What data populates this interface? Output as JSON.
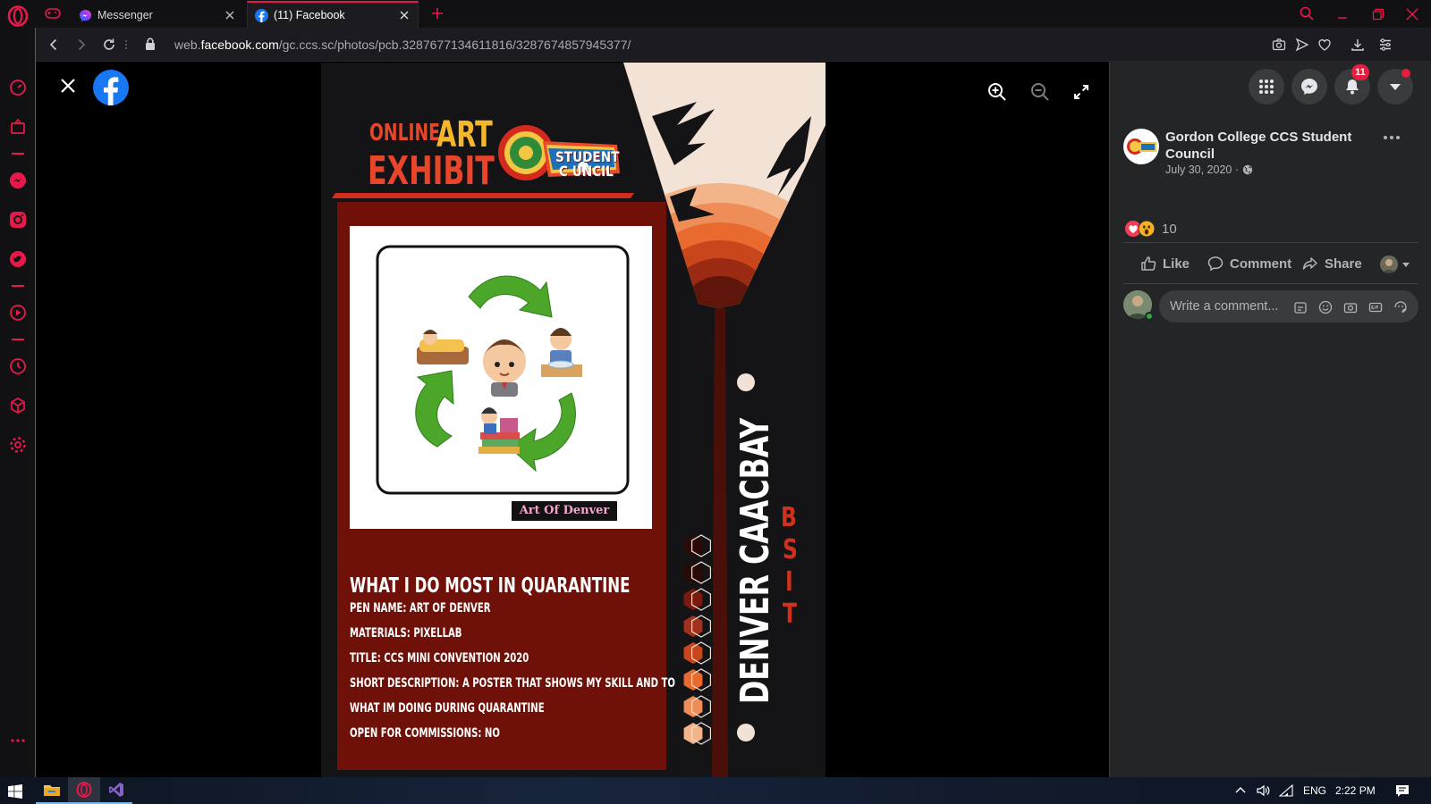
{
  "tabs": [
    {
      "title": "Messenger"
    },
    {
      "title": "(11) Facebook"
    }
  ],
  "address": {
    "prefix": "web.",
    "domain": "facebook.com",
    "path": "/gc.ccs.sc/photos/pcb.3287677134611816/3287674857945377/"
  },
  "poster": {
    "header_line1_a": "ONLINE",
    "header_line1_b": "ART",
    "header_line2": "EXHIBIT",
    "council_top": "STUDENT",
    "council_bottom": "C  UNCIL",
    "art_tag": "Art Of Denver",
    "heading": "WHAT I DO MOST IN QUARANTINE",
    "lines": [
      "PEN NAME: ART OF DENVER",
      "MATERIALS: PIXELLAB",
      "TITLE: CCS MINI CONVENTION 2020",
      "SHORT DESCRIPTION: A POSTER THAT SHOWS MY SKILL AND TO",
      "WHAT IM DOING DURING QUARANTINE",
      "OPEN FOR COMMISSIONS: NO"
    ],
    "artist_name": "DENVER CAACBAY",
    "course": [
      "B",
      "S",
      "I",
      "T"
    ]
  },
  "post": {
    "page_name": "Gordon College CCS Student Council",
    "date": "July 30, 2020 ·",
    "reaction_count": "10",
    "like_label": "Like",
    "comment_label": "Comment",
    "share_label": "Share",
    "comment_placeholder": "Write a comment..."
  },
  "header": {
    "notification_count": "11"
  },
  "taskbar": {
    "language": "ENG",
    "time": "2:22 PM"
  },
  "colors": {
    "opera_red": "#e8194a",
    "fb_blue": "#1877f2",
    "poster_maroon": "#6f1109",
    "poster_orange": "#e86a2f"
  }
}
